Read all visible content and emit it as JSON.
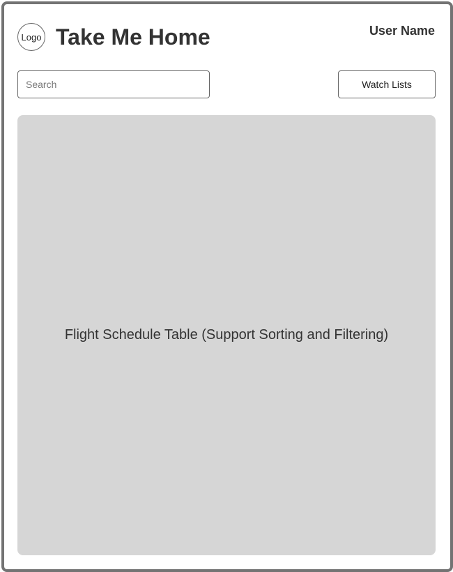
{
  "header": {
    "logo_label": "Logo",
    "title": "Take Me Home",
    "user_name": "User Name"
  },
  "toolbar": {
    "search_placeholder": "Search",
    "watch_lists_label": "Watch Lists"
  },
  "main": {
    "table_placeholder": "Flight Schedule Table (Support Sorting and Filtering)"
  },
  "colors": {
    "frame_border": "#737373",
    "table_background": "#d6d6d6",
    "text": "#333333"
  }
}
